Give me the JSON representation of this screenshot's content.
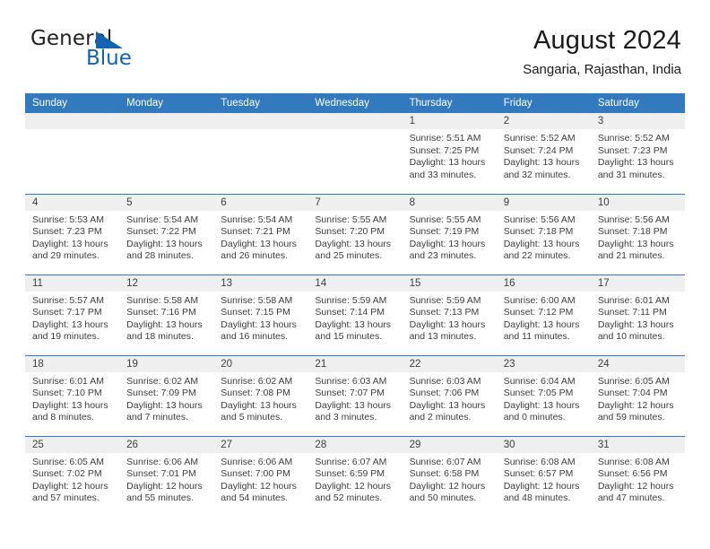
{
  "brand": {
    "name_part1": "General",
    "name_part2": "Blue",
    "flag_icon": "triangle-flag-icon",
    "accent_color": "#1263b0"
  },
  "header": {
    "title": "August 2024",
    "subtitle": "Sangaria, Rajasthan, India"
  },
  "theme": {
    "header_bg": "#3279bd",
    "daynum_bg": "#efefef",
    "text": "#3c3c3c",
    "rule": "#3279bd"
  },
  "weekday_headers": [
    "Sunday",
    "Monday",
    "Tuesday",
    "Wednesday",
    "Thursday",
    "Friday",
    "Saturday"
  ],
  "weeks": [
    [
      {
        "day": "",
        "sunrise": "",
        "sunset": "",
        "daylight_line1": "",
        "daylight_line2": ""
      },
      {
        "day": "",
        "sunrise": "",
        "sunset": "",
        "daylight_line1": "",
        "daylight_line2": ""
      },
      {
        "day": "",
        "sunrise": "",
        "sunset": "",
        "daylight_line1": "",
        "daylight_line2": ""
      },
      {
        "day": "",
        "sunrise": "",
        "sunset": "",
        "daylight_line1": "",
        "daylight_line2": ""
      },
      {
        "day": "1",
        "sunrise": "Sunrise: 5:51 AM",
        "sunset": "Sunset: 7:25 PM",
        "daylight_line1": "Daylight: 13 hours",
        "daylight_line2": "and 33 minutes."
      },
      {
        "day": "2",
        "sunrise": "Sunrise: 5:52 AM",
        "sunset": "Sunset: 7:24 PM",
        "daylight_line1": "Daylight: 13 hours",
        "daylight_line2": "and 32 minutes."
      },
      {
        "day": "3",
        "sunrise": "Sunrise: 5:52 AM",
        "sunset": "Sunset: 7:23 PM",
        "daylight_line1": "Daylight: 13 hours",
        "daylight_line2": "and 31 minutes."
      }
    ],
    [
      {
        "day": "4",
        "sunrise": "Sunrise: 5:53 AM",
        "sunset": "Sunset: 7:23 PM",
        "daylight_line1": "Daylight: 13 hours",
        "daylight_line2": "and 29 minutes."
      },
      {
        "day": "5",
        "sunrise": "Sunrise: 5:54 AM",
        "sunset": "Sunset: 7:22 PM",
        "daylight_line1": "Daylight: 13 hours",
        "daylight_line2": "and 28 minutes."
      },
      {
        "day": "6",
        "sunrise": "Sunrise: 5:54 AM",
        "sunset": "Sunset: 7:21 PM",
        "daylight_line1": "Daylight: 13 hours",
        "daylight_line2": "and 26 minutes."
      },
      {
        "day": "7",
        "sunrise": "Sunrise: 5:55 AM",
        "sunset": "Sunset: 7:20 PM",
        "daylight_line1": "Daylight: 13 hours",
        "daylight_line2": "and 25 minutes."
      },
      {
        "day": "8",
        "sunrise": "Sunrise: 5:55 AM",
        "sunset": "Sunset: 7:19 PM",
        "daylight_line1": "Daylight: 13 hours",
        "daylight_line2": "and 23 minutes."
      },
      {
        "day": "9",
        "sunrise": "Sunrise: 5:56 AM",
        "sunset": "Sunset: 7:18 PM",
        "daylight_line1": "Daylight: 13 hours",
        "daylight_line2": "and 22 minutes."
      },
      {
        "day": "10",
        "sunrise": "Sunrise: 5:56 AM",
        "sunset": "Sunset: 7:18 PM",
        "daylight_line1": "Daylight: 13 hours",
        "daylight_line2": "and 21 minutes."
      }
    ],
    [
      {
        "day": "11",
        "sunrise": "Sunrise: 5:57 AM",
        "sunset": "Sunset: 7:17 PM",
        "daylight_line1": "Daylight: 13 hours",
        "daylight_line2": "and 19 minutes."
      },
      {
        "day": "12",
        "sunrise": "Sunrise: 5:58 AM",
        "sunset": "Sunset: 7:16 PM",
        "daylight_line1": "Daylight: 13 hours",
        "daylight_line2": "and 18 minutes."
      },
      {
        "day": "13",
        "sunrise": "Sunrise: 5:58 AM",
        "sunset": "Sunset: 7:15 PM",
        "daylight_line1": "Daylight: 13 hours",
        "daylight_line2": "and 16 minutes."
      },
      {
        "day": "14",
        "sunrise": "Sunrise: 5:59 AM",
        "sunset": "Sunset: 7:14 PM",
        "daylight_line1": "Daylight: 13 hours",
        "daylight_line2": "and 15 minutes."
      },
      {
        "day": "15",
        "sunrise": "Sunrise: 5:59 AM",
        "sunset": "Sunset: 7:13 PM",
        "daylight_line1": "Daylight: 13 hours",
        "daylight_line2": "and 13 minutes."
      },
      {
        "day": "16",
        "sunrise": "Sunrise: 6:00 AM",
        "sunset": "Sunset: 7:12 PM",
        "daylight_line1": "Daylight: 13 hours",
        "daylight_line2": "and 11 minutes."
      },
      {
        "day": "17",
        "sunrise": "Sunrise: 6:01 AM",
        "sunset": "Sunset: 7:11 PM",
        "daylight_line1": "Daylight: 13 hours",
        "daylight_line2": "and 10 minutes."
      }
    ],
    [
      {
        "day": "18",
        "sunrise": "Sunrise: 6:01 AM",
        "sunset": "Sunset: 7:10 PM",
        "daylight_line1": "Daylight: 13 hours",
        "daylight_line2": "and 8 minutes."
      },
      {
        "day": "19",
        "sunrise": "Sunrise: 6:02 AM",
        "sunset": "Sunset: 7:09 PM",
        "daylight_line1": "Daylight: 13 hours",
        "daylight_line2": "and 7 minutes."
      },
      {
        "day": "20",
        "sunrise": "Sunrise: 6:02 AM",
        "sunset": "Sunset: 7:08 PM",
        "daylight_line1": "Daylight: 13 hours",
        "daylight_line2": "and 5 minutes."
      },
      {
        "day": "21",
        "sunrise": "Sunrise: 6:03 AM",
        "sunset": "Sunset: 7:07 PM",
        "daylight_line1": "Daylight: 13 hours",
        "daylight_line2": "and 3 minutes."
      },
      {
        "day": "22",
        "sunrise": "Sunrise: 6:03 AM",
        "sunset": "Sunset: 7:06 PM",
        "daylight_line1": "Daylight: 13 hours",
        "daylight_line2": "and 2 minutes."
      },
      {
        "day": "23",
        "sunrise": "Sunrise: 6:04 AM",
        "sunset": "Sunset: 7:05 PM",
        "daylight_line1": "Daylight: 13 hours",
        "daylight_line2": "and 0 minutes."
      },
      {
        "day": "24",
        "sunrise": "Sunrise: 6:05 AM",
        "sunset": "Sunset: 7:04 PM",
        "daylight_line1": "Daylight: 12 hours",
        "daylight_line2": "and 59 minutes."
      }
    ],
    [
      {
        "day": "25",
        "sunrise": "Sunrise: 6:05 AM",
        "sunset": "Sunset: 7:02 PM",
        "daylight_line1": "Daylight: 12 hours",
        "daylight_line2": "and 57 minutes."
      },
      {
        "day": "26",
        "sunrise": "Sunrise: 6:06 AM",
        "sunset": "Sunset: 7:01 PM",
        "daylight_line1": "Daylight: 12 hours",
        "daylight_line2": "and 55 minutes."
      },
      {
        "day": "27",
        "sunrise": "Sunrise: 6:06 AM",
        "sunset": "Sunset: 7:00 PM",
        "daylight_line1": "Daylight: 12 hours",
        "daylight_line2": "and 54 minutes."
      },
      {
        "day": "28",
        "sunrise": "Sunrise: 6:07 AM",
        "sunset": "Sunset: 6:59 PM",
        "daylight_line1": "Daylight: 12 hours",
        "daylight_line2": "and 52 minutes."
      },
      {
        "day": "29",
        "sunrise": "Sunrise: 6:07 AM",
        "sunset": "Sunset: 6:58 PM",
        "daylight_line1": "Daylight: 12 hours",
        "daylight_line2": "and 50 minutes."
      },
      {
        "day": "30",
        "sunrise": "Sunrise: 6:08 AM",
        "sunset": "Sunset: 6:57 PM",
        "daylight_line1": "Daylight: 12 hours",
        "daylight_line2": "and 48 minutes."
      },
      {
        "day": "31",
        "sunrise": "Sunrise: 6:08 AM",
        "sunset": "Sunset: 6:56 PM",
        "daylight_line1": "Daylight: 12 hours",
        "daylight_line2": "and 47 minutes."
      }
    ]
  ]
}
